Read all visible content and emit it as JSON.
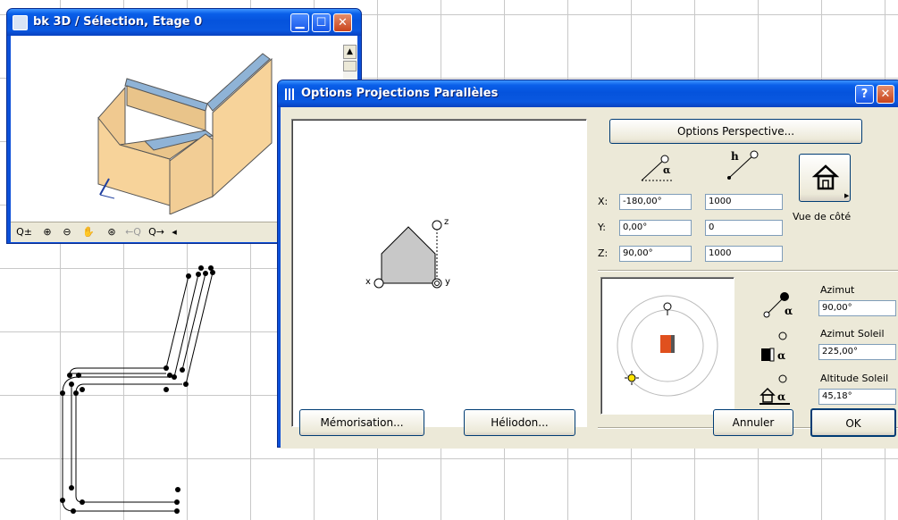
{
  "window_3d": {
    "title": "bk 3D / Sélection, Etage 0",
    "toolbar": [
      "Q±",
      "⊕",
      "⊖",
      "✋",
      "⊛",
      "←Q",
      "Q→",
      "◂"
    ]
  },
  "dialog": {
    "title": "Options Projections Parallèles",
    "help_label": "?",
    "close_label": "✕",
    "perspective_button": "Options Perspective...",
    "vue_label": "Vue de côté",
    "rows": [
      {
        "label": "X:",
        "angle": "-180,00°",
        "distance": "1000"
      },
      {
        "label": "Y:",
        "angle": "0,00°",
        "distance": "0"
      },
      {
        "label": "Z:",
        "angle": "90,00°",
        "distance": "1000"
      }
    ],
    "preview_axis": {
      "z": "z",
      "x": "x",
      "y": "y"
    },
    "sun": {
      "azimut_label": "Azimut",
      "azimut_value": "90,00°",
      "azimut_soleil_label": "Azimut Soleil",
      "azimut_soleil_value": "225,00°",
      "altitude_soleil_label": "Altitude Soleil",
      "altitude_soleil_value": "45,18°"
    },
    "buttons": {
      "memorisation": "Mémorisation...",
      "heliodon": "Héliodon...",
      "annuler": "Annuler",
      "ok": "OK"
    }
  },
  "colors": {
    "xp_title_blue": "#0553dc",
    "dialog_bg": "#ece9d8",
    "model_tan": "#f7d39a",
    "model_blue": "#8fb3d6",
    "sun_box_orange": "#e0501e"
  }
}
